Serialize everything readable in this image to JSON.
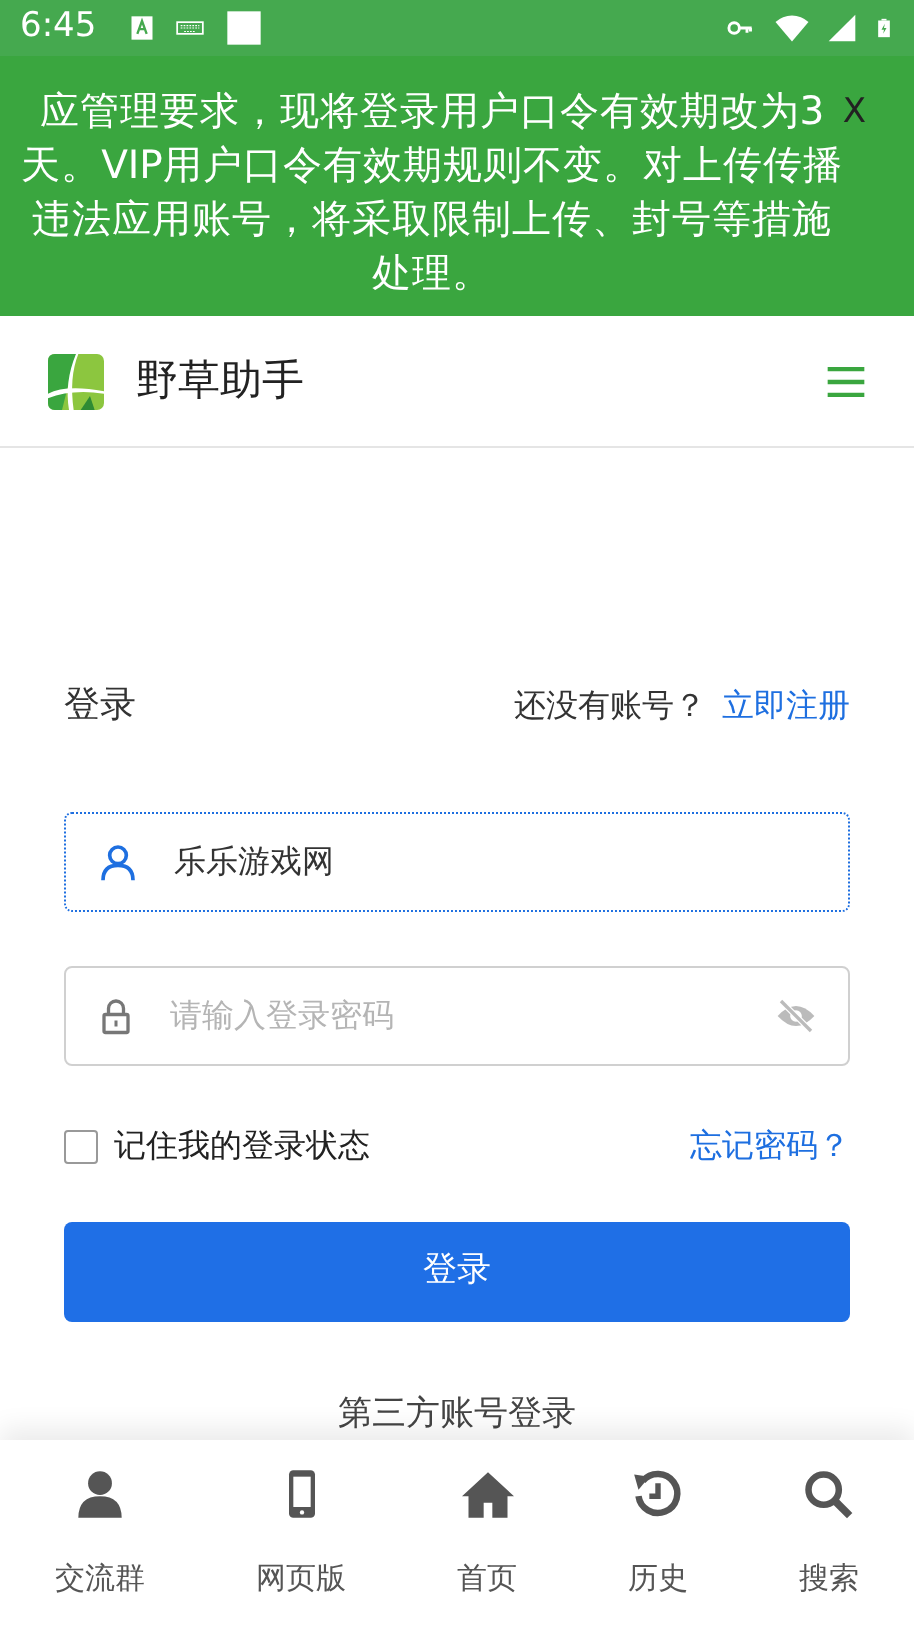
{
  "status_bar": {
    "time": "6:45"
  },
  "notice": {
    "text": "应管理要求，现将登录用户口令有效期改为3天。VIP用户口令有效期规则不变。对上传传播违法应用账号，将采取限制上传、封号等措施处理。",
    "close": "X"
  },
  "header": {
    "title": "野草助手"
  },
  "login": {
    "title": "登录",
    "prompt": "还没有账号？",
    "register": "立即注册",
    "username": {
      "value": "乐乐游戏网",
      "focused": true
    },
    "password": {
      "placeholder": "请输入登录密码"
    },
    "remember": {
      "label": "记住我的登录状态",
      "checked": false
    },
    "forgot": "忘记密码？",
    "submit": "登录",
    "third_party": "第三方账号登录"
  },
  "bottom_nav": [
    {
      "kind": "user",
      "label": "交流群"
    },
    {
      "kind": "phone",
      "label": "网页版"
    },
    {
      "kind": "home",
      "label": "首页"
    },
    {
      "kind": "history",
      "label": "历史"
    },
    {
      "kind": "search",
      "label": "搜索"
    }
  ]
}
